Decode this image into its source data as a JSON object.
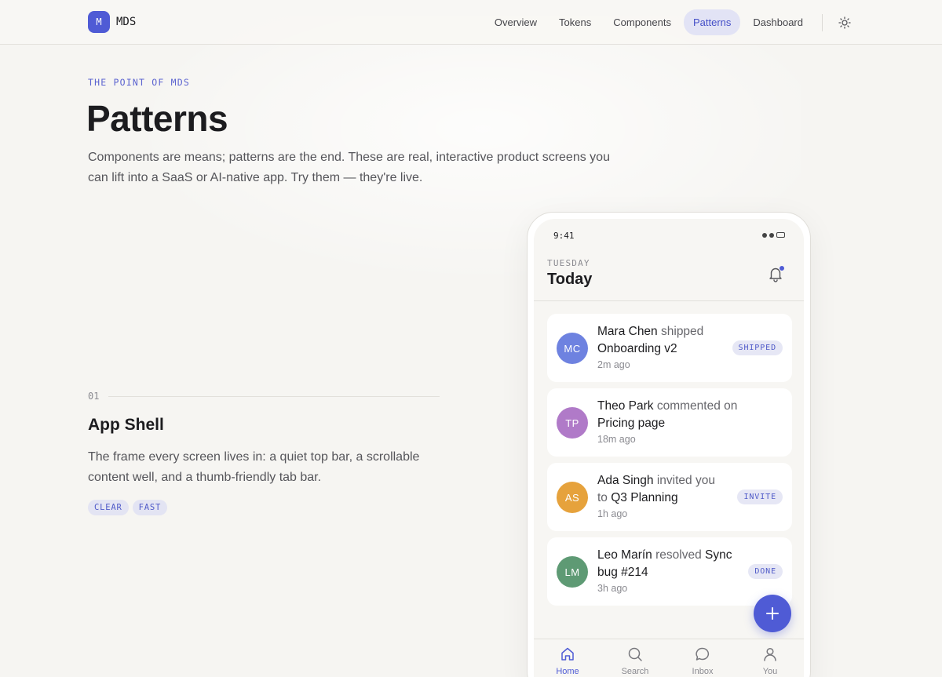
{
  "brand": {
    "mark": "M",
    "name": "MDS"
  },
  "nav": {
    "items": [
      {
        "label": "Overview",
        "active": false
      },
      {
        "label": "Tokens",
        "active": false
      },
      {
        "label": "Components",
        "active": false
      },
      {
        "label": "Patterns",
        "active": true
      },
      {
        "label": "Dashboard",
        "active": false
      }
    ],
    "theme_icon": "sun-icon"
  },
  "hero": {
    "eyebrow": "THE POINT OF MDS",
    "title": "Patterns",
    "lede": "Components are means; patterns are the end. These are real, interactive product screens you can lift into a SaaS or AI-native app. Try them — they're live."
  },
  "section": {
    "number": "01",
    "title": "App Shell",
    "description": "The frame every screen lives in: a quiet top bar, a scrollable content well, and a thumb-friendly tab bar.",
    "tags": [
      "CLEAR",
      "FAST"
    ]
  },
  "phone": {
    "status_time": "9:41",
    "day": "TUESDAY",
    "heading": "Today",
    "feed": [
      {
        "initials": "MC",
        "avatar_color": "#6e82e0",
        "actor": "Mara Chen",
        "verb": "shipped",
        "object": "Onboarding v2",
        "time": "2m ago",
        "badge": "SHIPPED"
      },
      {
        "initials": "TP",
        "avatar_color": "#b07ac8",
        "actor": "Theo Park",
        "verb": "commented on",
        "object": "Pricing page",
        "time": "18m ago",
        "badge": ""
      },
      {
        "initials": "AS",
        "avatar_color": "#e6a23c",
        "actor": "Ada Singh",
        "verb": "invited you to",
        "object": "Q3 Planning",
        "time": "1h ago",
        "badge": "INVITE"
      },
      {
        "initials": "LM",
        "avatar_color": "#5e9a74",
        "actor": "Leo Marín",
        "verb": "resolved",
        "object": "Sync bug #214",
        "time": "3h ago",
        "badge": "DONE"
      }
    ],
    "tabs": [
      {
        "label": "Home",
        "icon": "home-icon",
        "active": true
      },
      {
        "label": "Search",
        "icon": "search-icon",
        "active": false
      },
      {
        "label": "Inbox",
        "icon": "chat-icon",
        "active": false
      },
      {
        "label": "You",
        "icon": "user-icon",
        "active": false
      }
    ]
  },
  "colors": {
    "accent": "#4f5bd5",
    "background": "#f6f5f2"
  }
}
